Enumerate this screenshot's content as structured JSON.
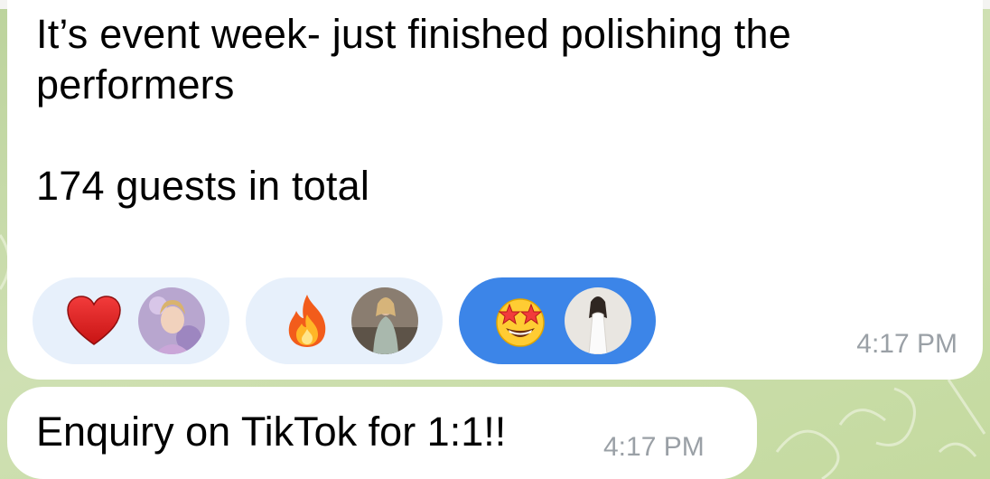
{
  "message1": {
    "text": "It’s event week- just finished polishing the\nperformers\n\n174 guests in total",
    "time": "4:17 PM",
    "reactions": [
      {
        "emoji": "heart-emoji",
        "avatar": "woman-lavender-avatar",
        "active": false
      },
      {
        "emoji": "fire-emoji",
        "avatar": "woman-grey-dress-avatar",
        "active": false
      },
      {
        "emoji": "star-struck-emoji",
        "avatar": "woman-white-outfit-avatar",
        "active": true
      }
    ]
  },
  "message2": {
    "text": "Enquiry on TikTok for 1:1!!",
    "time": "4:17 PM"
  },
  "colors": {
    "reaction_bg": "#e7f0fb",
    "reaction_active_bg": "#3c85e8",
    "timestamp": "#9aa0a6"
  }
}
